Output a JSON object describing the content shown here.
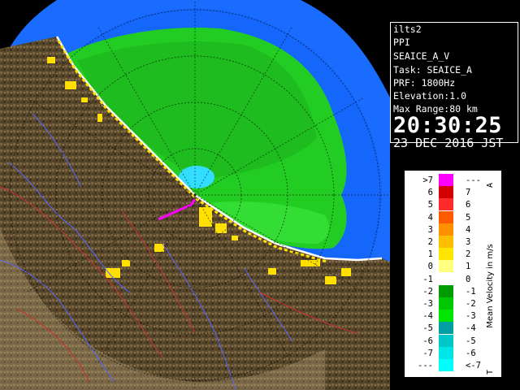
{
  "info": {
    "site": "ilts2",
    "mode": "PPI",
    "task": "SEAICE_A_V",
    "task_line": "Task: SEAICE_A",
    "prf": "PRF: 1800Hz",
    "elevation": "Elevation:1.0",
    "max_range": "Max Range:80 km",
    "time": "20:30:25",
    "date": "23 DEC 2016 JST"
  },
  "legend": {
    "title": "Mean Velocity in m/s",
    "top_marker": "A",
    "bottom_marker": "T",
    "left_labels": [
      ">7",
      "6",
      "5",
      "4",
      "3",
      "2",
      "1",
      "0",
      "-1",
      "-2",
      "-3",
      "-4",
      "-5",
      "-6",
      "-7",
      "---"
    ],
    "right_labels": [
      "---",
      "7",
      "6",
      "5",
      "4",
      "3",
      "2",
      "1",
      "0",
      "-1",
      "-2",
      "-3",
      "-4",
      "-5",
      "-6",
      "<-7"
    ],
    "colors": [
      "#ff00ff",
      "#d30000",
      "#ff2a2a",
      "#ff5a00",
      "#ff9100",
      "#ffbf00",
      "#ffe600",
      "#ffff80",
      "#ffffff",
      "#009b00",
      "#00c800",
      "#00e600",
      "#00a0a0",
      "#00c8c8",
      "#00e6e6",
      "#00ffff"
    ]
  },
  "colors": {
    "outer_ocean": "#1a6cff",
    "terrain": "#5b4a2c",
    "echo_green": "#22cc22",
    "coast_yellow": "#ffe000",
    "cyan_patch": "#33ddff"
  }
}
